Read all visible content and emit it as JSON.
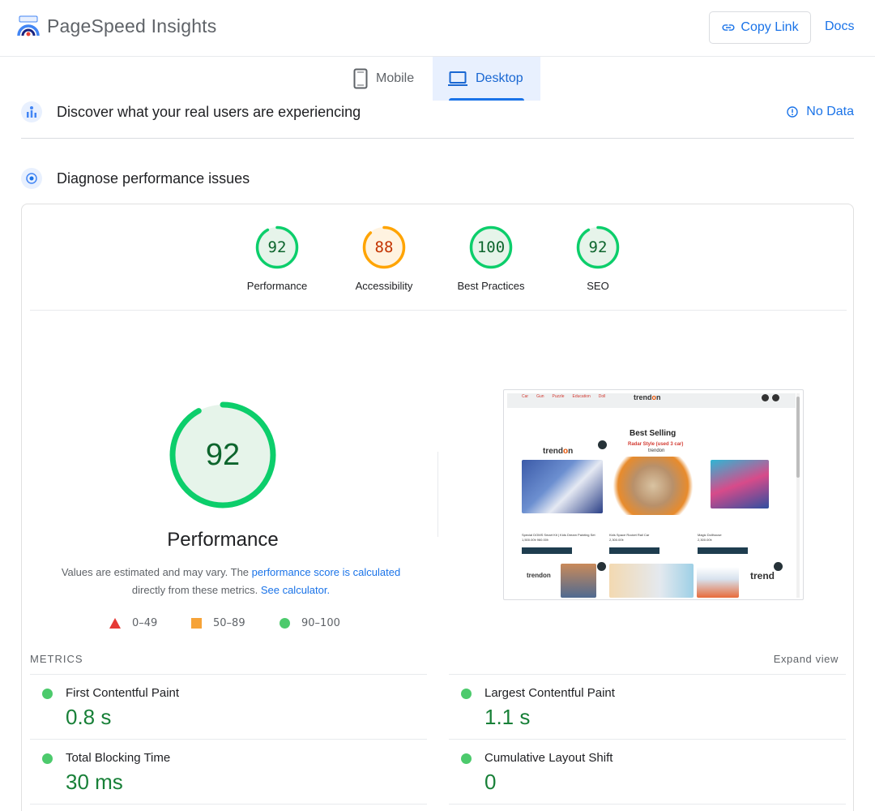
{
  "app": {
    "title": "PageSpeed Insights",
    "copy_link": "Copy Link",
    "docs": "Docs"
  },
  "tabs": [
    {
      "label": "Mobile",
      "icon": "smartphone-icon",
      "selected": false
    },
    {
      "label": "Desktop",
      "icon": "laptop-icon",
      "selected": true
    }
  ],
  "field_data": {
    "title": "Discover what your real users are experiencing",
    "status": "No Data"
  },
  "diagnose": {
    "title": "Diagnose performance issues"
  },
  "scores": [
    {
      "label": "Performance",
      "value": "92",
      "color": "#0cce6b"
    },
    {
      "label": "Accessibility",
      "value": "88",
      "color": "#ffa400"
    },
    {
      "label": "Best Practices",
      "value": "100",
      "color": "#0cce6b"
    },
    {
      "label": "SEO",
      "value": "92",
      "color": "#0cce6b"
    }
  ],
  "performance": {
    "score": "92",
    "title": "Performance",
    "desc_pre": "Values are estimated and may vary. The ",
    "desc_link1": "performance score is calculated",
    "desc_mid": "directly from these metrics. ",
    "desc_link2": "See calculator."
  },
  "legend": [
    {
      "range": "0–49",
      "shape": "triangle",
      "color": "#e53935"
    },
    {
      "range": "50–89",
      "shape": "square",
      "color": "#f6a338"
    },
    {
      "range": "90–100",
      "shape": "circle",
      "color": "#4cca6c"
    }
  ],
  "screenshot": {
    "nav_links": [
      "Car",
      "Gun",
      "Puzzle",
      "Education",
      "Doll"
    ],
    "brand_a": "trend",
    "brand_b": "o",
    "brand_c": "n",
    "heading": "Best Selling",
    "sub": "Radar Style (used 3 car)",
    "sub2": "trendon",
    "products": [
      {
        "name": "Special DOMS Smart Kit | Kids Dream Painting Set",
        "price": "1,500.00৳ 960.00৳"
      },
      {
        "name": "Kids Space Rocket Rail Car",
        "price": "2,300.00৳"
      },
      {
        "name": "Magic Dollhouse",
        "price": "2,300.00৳"
      }
    ],
    "bottom_logos": [
      "trendon",
      "trend"
    ]
  },
  "metrics": {
    "label": "METRICS",
    "expand": "Expand view",
    "items": [
      {
        "name": "First Contentful Paint",
        "value": "0.8 s",
        "rating": "good"
      },
      {
        "name": "Largest Contentful Paint",
        "value": "1.1 s",
        "rating": "good"
      },
      {
        "name": "Total Blocking Time",
        "value": "30 ms",
        "rating": "good"
      },
      {
        "name": "Cumulative Layout Shift",
        "value": "0",
        "rating": "good"
      }
    ]
  }
}
